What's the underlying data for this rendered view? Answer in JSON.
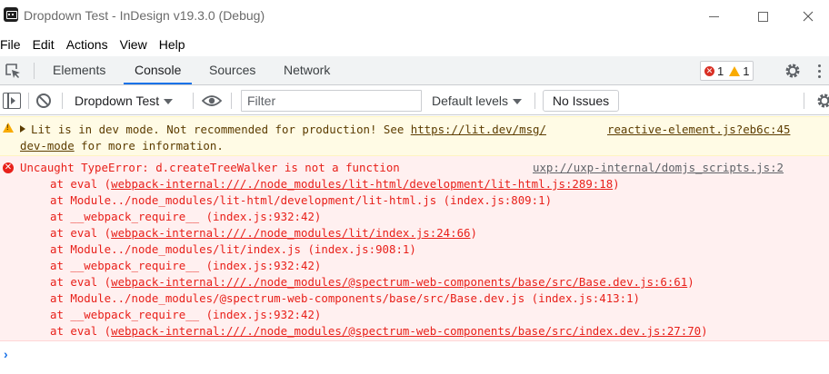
{
  "window": {
    "title": "Dropdown Test - InDesign v19.3.0 (Debug)",
    "minimize": "minimize",
    "maximize": "maximize",
    "close": "close"
  },
  "menu": [
    "File",
    "Edit",
    "Actions",
    "View",
    "Help"
  ],
  "tabs": [
    "Elements",
    "Console",
    "Sources",
    "Network"
  ],
  "active_tab": "Console",
  "issue_counter": {
    "errors": "1",
    "warnings": "1"
  },
  "toolbar": {
    "context": "Dropdown Test",
    "filter_placeholder": "Filter",
    "levels": "Default levels",
    "issues": "No Issues"
  },
  "warning": {
    "text": "Lit is in dev mode. Not recommended for production! See ",
    "link1": "https://lit.dev/msg/",
    "source": "reactive-element.js?eb6c:45",
    "link2": "dev-mode",
    "tail": " for more information."
  },
  "error": {
    "message": "Uncaught TypeError: d.createTreeWalker is not a function",
    "source": "uxp://uxp-internal/domjs_scripts.js:2",
    "stack": [
      {
        "pre": "at eval (",
        "link": "webpack-internal:///./node_modules/lit-html/development/lit-html.js:289:18",
        "post": ")"
      },
      {
        "pre": "at Module../node_modules/lit-html/development/lit-html.js (index.js:809:1)",
        "link": "",
        "post": ""
      },
      {
        "pre": "at __webpack_require__ (index.js:932:42)",
        "link": "",
        "post": ""
      },
      {
        "pre": "at eval (",
        "link": "webpack-internal:///./node_modules/lit/index.js:24:66",
        "post": ")"
      },
      {
        "pre": "at Module../node_modules/lit/index.js (index.js:908:1)",
        "link": "",
        "post": ""
      },
      {
        "pre": "at __webpack_require__ (index.js:932:42)",
        "link": "",
        "post": ""
      },
      {
        "pre": "at eval (",
        "link": "webpack-internal:///./node_modules/@spectrum-web-components/base/src/Base.dev.js:6:61",
        "post": ")"
      },
      {
        "pre": "at Module../node_modules/@spectrum-web-components/base/src/Base.dev.js (index.js:413:1)",
        "link": "",
        "post": ""
      },
      {
        "pre": "at __webpack_require__ (index.js:932:42)",
        "link": "",
        "post": ""
      },
      {
        "pre": "at eval (",
        "link": "webpack-internal:///./node_modules/@spectrum-web-components/base/src/index.dev.js:27:70",
        "post": ")"
      }
    ]
  },
  "prompt": "›",
  "colors": {
    "accent": "#1a73e8",
    "error_text": "#e8201a",
    "error_bg": "#fff0f0",
    "warning_bg": "#fffbe5",
    "warning_text": "#5c3c00"
  }
}
